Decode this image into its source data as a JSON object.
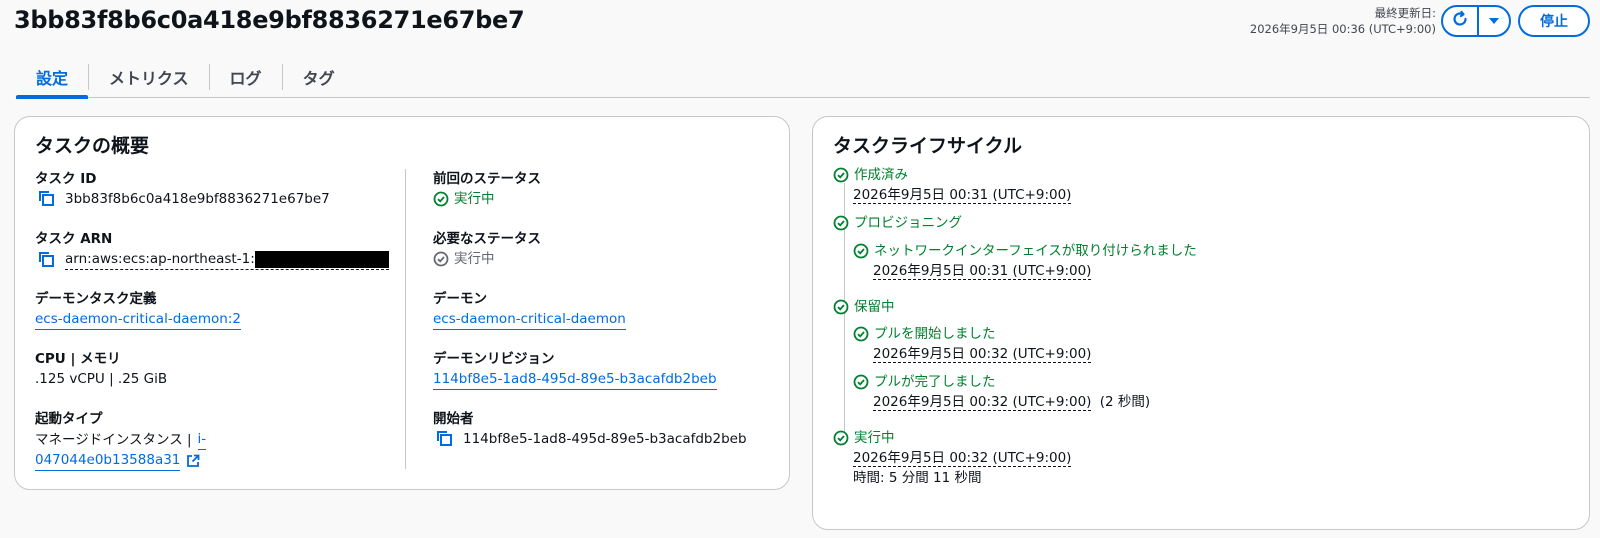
{
  "header": {
    "title": "3bb83f8b6c0a418e9bf8836271e67be7",
    "last_updated_label": "最終更新日:",
    "last_updated_value": "2026年9月5日 00:36 (UTC+9:00)",
    "stop_label": "停止"
  },
  "tabs": [
    {
      "label": "設定",
      "active": true
    },
    {
      "label": "メトリクス",
      "active": false
    },
    {
      "label": "ログ",
      "active": false
    },
    {
      "label": "タグ",
      "active": false
    }
  ],
  "overview": {
    "title": "タスクの概要",
    "task_id": {
      "label": "タスク ID",
      "value": "3bb83f8b6c0a418e9bf8836271e67be7"
    },
    "task_arn": {
      "label": "タスク ARN",
      "value": "arn:aws:ecs:ap-northeast-1:"
    },
    "daemon_task_def": {
      "label": "デーモンタスク定義",
      "value": "ecs-daemon-critical-daemon:2"
    },
    "cpu_memory": {
      "label": "CPU | メモリ",
      "value": ".125 vCPU | .25 GiB"
    },
    "launch_type": {
      "label": "起動タイプ",
      "value": "マネージドインスタンス |",
      "instance_link_1": "i-",
      "instance_link_2": "047044e0b13588a31"
    },
    "last_status": {
      "label": "前回のステータス",
      "value": "実行中"
    },
    "desired_status": {
      "label": "必要なステータス",
      "value": "実行中"
    },
    "daemon": {
      "label": "デーモン",
      "value": "ecs-daemon-critical-daemon"
    },
    "daemon_revision": {
      "label": "デーモンリビジョン",
      "value": "114bf8e5-1ad8-495d-89e5-b3acafdb2beb"
    },
    "started_by": {
      "label": "開始者",
      "value": "114bf8e5-1ad8-495d-89e5-b3acafdb2beb"
    }
  },
  "lifecycle": {
    "title": "タスクライフサイクル",
    "created": {
      "label": "作成済み",
      "time": "2026年9月5日 00:31 (UTC+9:00)"
    },
    "provisioning": {
      "label": "プロビジョニング"
    },
    "eni": {
      "label": "ネットワークインターフェイスが取り付けられました",
      "time": "2026年9月5日 00:31 (UTC+9:00)"
    },
    "pending": {
      "label": "保留中"
    },
    "pull_started": {
      "label": "プルを開始しました",
      "time": "2026年9月5日 00:32 (UTC+9:00)"
    },
    "pull_completed": {
      "label": "プルが完了しました",
      "time": "2026年9月5日 00:32 (UTC+9:00)",
      "duration": "(2 秒間)"
    },
    "running": {
      "label": "実行中",
      "time": "2026年9月5日 00:32 (UTC+9:00)",
      "elapsed": "時間: 5 分間 11 秒間"
    }
  },
  "colors": {
    "accent": "#006ce0",
    "success": "#00802f",
    "muted": "#656871"
  }
}
